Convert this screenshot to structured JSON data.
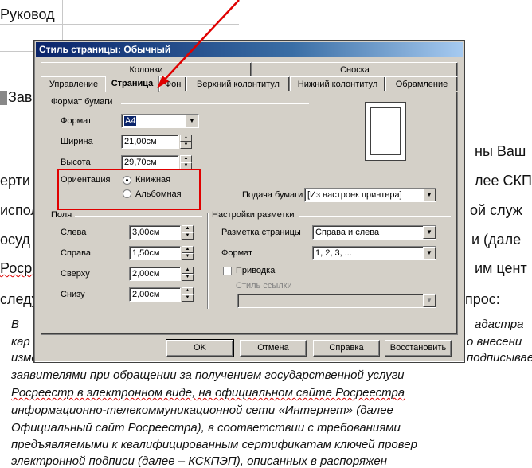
{
  "background_doc": {
    "header_word": "Руковод",
    "lines": [
      "Зав",
      "ны   Ваш",
      "ерти",
      "лее СКПЗ",
      "испол",
      "ой служ",
      "осуд",
      "и  (дале",
      "Росре",
      "им  цент",
      "следу",
      "прос:"
    ],
    "italic_lines": [
      "В",
      "адастра",
      "кар",
      "о внесени",
      "изменени",
      "подписываемо",
      "заявителями при обращении за получением государственной услуги",
      "Росреестр в электронном виде, на официальном сайте Росреестра",
      "информационно-телекоммуникационной сети «Интернет» (далее",
      "Официальный сайт Росреестра), в соответствии с требованиями",
      "предъявляемыми к квалифицированным сертификатам ключей провер",
      "электронной подписи (далее – КСКПЭП), описанных в распоряжен"
    ]
  },
  "dialog": {
    "title": "Стиль страницы: Обычный",
    "tabs_row1": [
      "Колонки",
      "Сноска"
    ],
    "tabs_row2": [
      "Управление",
      "Страница",
      "Фон",
      "Верхний колонтитул",
      "Нижний колонтитул",
      "Обрамление"
    ],
    "active_tab": "Страница",
    "paper_format": {
      "group": "Формат бумаги",
      "format_label": "Формат",
      "format_value": "A4",
      "width_label": "Ширина",
      "width_value": "21,00см",
      "height_label": "Высота",
      "height_value": "29,70см",
      "orientation_label": "Ориентация",
      "portrait_label": "Книжная",
      "landscape_label": "Альбомная",
      "orientation_selected": "portrait",
      "paper_source_label": "Подача бумаги",
      "paper_source_value": "[Из настроек принтера]"
    },
    "margins": {
      "group": "Поля",
      "left_label": "Слева",
      "left_value": "3,00см",
      "right_label": "Справа",
      "right_value": "1,50см",
      "top_label": "Сверху",
      "top_value": "2,00см",
      "bottom_label": "Снизу",
      "bottom_value": "2,00см"
    },
    "layout": {
      "group": "Настройки разметки",
      "page_layout_label": "Разметка страницы",
      "page_layout_value": "Справа и слева",
      "format_label": "Формат",
      "format_value": "1, 2, 3, ...",
      "register_label": "Приводка",
      "register_checked": false,
      "ref_style_label": "Стиль ссылки",
      "ref_style_value": ""
    },
    "buttons": {
      "ok": "OK",
      "cancel": "Отмена",
      "help": "Справка",
      "reset": "Восстановить"
    }
  },
  "colors": {
    "annotation_red": "#e00000",
    "dialog_bg": "#d4d0c8",
    "titlebar": "#0a246a"
  }
}
